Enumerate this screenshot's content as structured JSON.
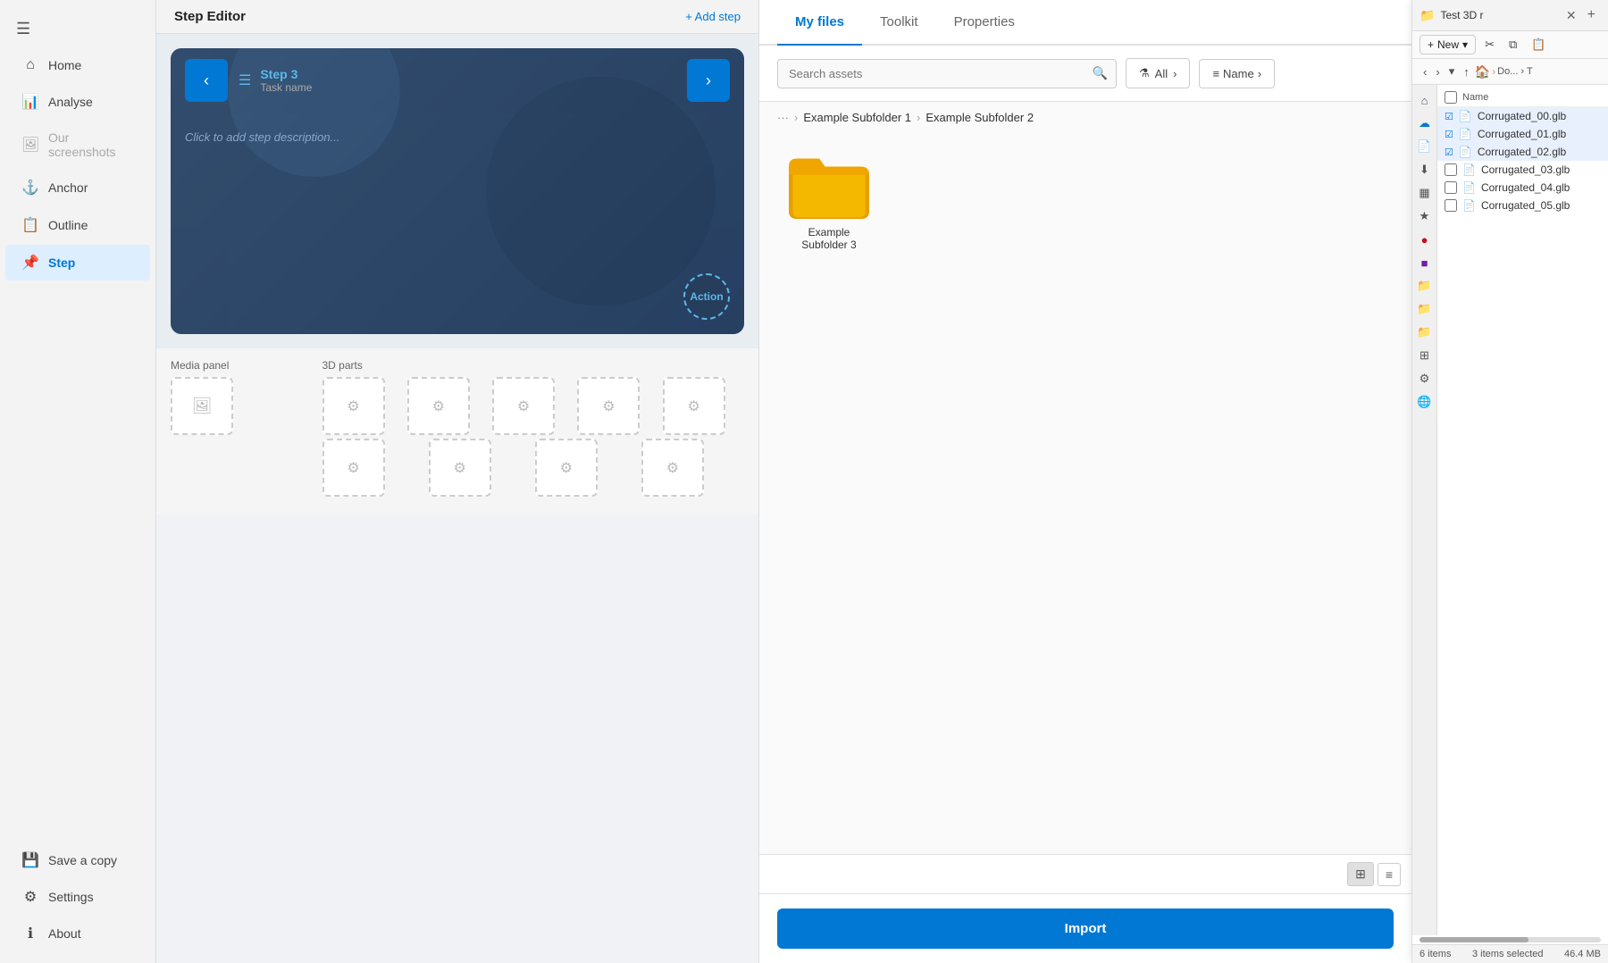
{
  "sidebar": {
    "menu_icon": "☰",
    "items": [
      {
        "id": "home",
        "label": "Home",
        "icon": "⌂",
        "active": false,
        "disabled": false
      },
      {
        "id": "analyse",
        "label": "Analyse",
        "icon": "📊",
        "active": false,
        "disabled": false
      },
      {
        "id": "our-screenshots",
        "label": "Our screenshots",
        "icon": "🖼",
        "active": false,
        "disabled": true
      },
      {
        "id": "anchor",
        "label": "Anchor",
        "icon": "⚓",
        "active": false,
        "disabled": false
      },
      {
        "id": "outline",
        "label": "Outline",
        "icon": "📋",
        "active": false,
        "disabled": false
      },
      {
        "id": "step",
        "label": "Step",
        "icon": "📌",
        "active": true,
        "disabled": false
      }
    ],
    "bottom_items": [
      {
        "id": "settings",
        "label": "Settings",
        "icon": "⚙",
        "active": false
      },
      {
        "id": "about",
        "label": "About",
        "icon": "ℹ",
        "active": false
      }
    ],
    "save_copy": {
      "label": "Save a copy",
      "icon": "💾"
    }
  },
  "step_editor": {
    "title": "Step Editor",
    "add_step_label": "+ Add step",
    "step_number": "Step 3",
    "task_name_label": "Task name",
    "description_placeholder": "Click to add step description...",
    "action_label": "Action",
    "media_panel_label": "Media panel",
    "three_d_parts_label": "3D parts"
  },
  "right_panel": {
    "tabs": [
      {
        "id": "my-files",
        "label": "My files",
        "active": true
      },
      {
        "id": "toolkit",
        "label": "Toolkit",
        "active": false
      },
      {
        "id": "properties",
        "label": "Properties",
        "active": false
      }
    ],
    "search": {
      "placeholder": "Search assets"
    },
    "filter_label": "All",
    "name_label": "Name",
    "breadcrumb": {
      "dots": "···",
      "items": [
        "Example Subfolder 1",
        "Example Subfolder 2"
      ]
    },
    "folder": {
      "name": "Example Subfolder 3"
    },
    "import_button": "Import",
    "view_toggle": {
      "grid_icon": "⊞",
      "list_icon": "≡"
    }
  },
  "explorer": {
    "tab_title": "Test 3D r",
    "tab_icon": "📁",
    "new_button": "New",
    "nav_path": "Do... › T",
    "files": [
      {
        "name": "Corrugated_00.glb",
        "checked": true
      },
      {
        "name": "Corrugated_01.glb",
        "checked": true
      },
      {
        "name": "Corrugated_02.glb",
        "checked": true
      },
      {
        "name": "Corrugated_03.glb",
        "checked": false
      },
      {
        "name": "Corrugated_04.glb",
        "checked": false
      },
      {
        "name": "Corrugated_05.glb",
        "checked": false
      }
    ],
    "status": {
      "item_count": "6 items",
      "selected_info": "3 items selected",
      "file_size": "46.4 MB"
    },
    "column_header": "Name"
  }
}
